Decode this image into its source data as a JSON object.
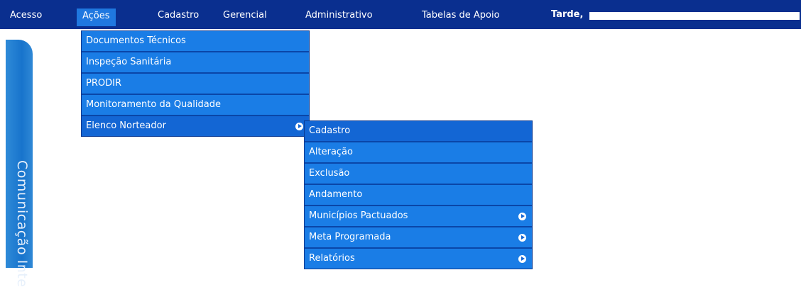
{
  "menubar": {
    "items": [
      {
        "label": "Acesso"
      },
      {
        "label": "Ações"
      },
      {
        "label": "Cadastro"
      },
      {
        "label": "Gerencial"
      },
      {
        "label": "Administrativo"
      },
      {
        "label": "Tabelas de Apoio"
      }
    ],
    "greeting": "Tarde,"
  },
  "side_tab": {
    "label": "Comunicação Inte"
  },
  "acoes_menu": {
    "items": [
      {
        "label": "Documentos Técnicos"
      },
      {
        "label": "Inspeção Sanitária"
      },
      {
        "label": "PRODIR"
      },
      {
        "label": "Monitoramento da Qualidade"
      },
      {
        "label": "Elenco Norteador"
      }
    ]
  },
  "elenco_submenu": {
    "items": [
      {
        "label": "Cadastro"
      },
      {
        "label": "Alteração"
      },
      {
        "label": "Exclusão"
      },
      {
        "label": "Andamento"
      },
      {
        "label": "Municípios Pactuados"
      },
      {
        "label": "Meta Programada"
      },
      {
        "label": "Relatórios"
      }
    ]
  },
  "colors": {
    "menubar_bg": "#0a2f8f",
    "menu_item_bg": "#1a7de6",
    "menu_item_selected": "#1366d4",
    "menu_text": "#ffffff"
  }
}
